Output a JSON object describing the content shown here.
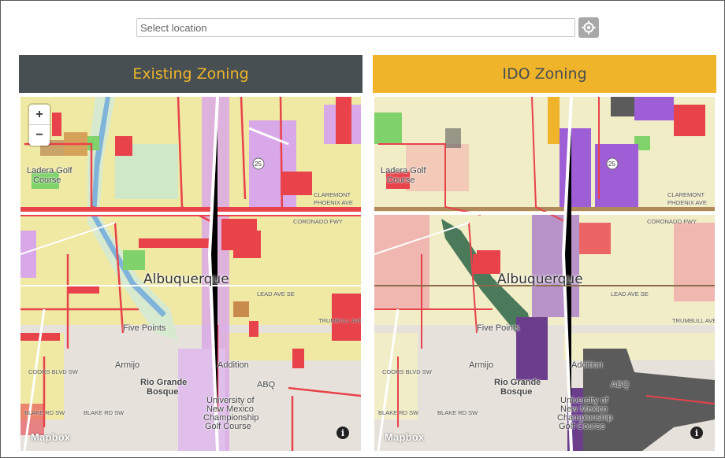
{
  "search": {
    "placeholder": "Select location"
  },
  "locate_icon": "crosshair-target-icon",
  "panels": {
    "existing": {
      "title": "Existing Zoning",
      "title_color": "#efb42a",
      "header_bg": "#474f52"
    },
    "ido": {
      "title": "IDO Zoning",
      "title_color": "#474f52",
      "header_bg": "#efb42a"
    }
  },
  "map": {
    "zoom_in": "+",
    "zoom_out": "−",
    "attribution": "Mapbox",
    "info": "i",
    "labels": {
      "city": "Albuquerque",
      "ladera_golf": "Ladera Golf",
      "ladera_course": "Course",
      "five_points": "Five Points",
      "armijo": "Armijo",
      "rio_grande": "Rio Grande",
      "bosque": "Bosque",
      "unm1": "University of",
      "unm2": "New Mexico",
      "unm3": "Championship",
      "unm4": "Golf Course",
      "abq": "ABQ",
      "addition": "Addition",
      "coronado": "CORONADO FWY",
      "lead": "LEAD AVE SE",
      "trumbull": "TRUMBULL AVE",
      "blake": "BLAKE RD SW",
      "coors": "COORS BLVD SW",
      "claremont1": "CLAREMONT",
      "claremont2": "PHOENIX AVE",
      "i25": "25"
    }
  },
  "colors": {
    "residential": "#efe9a3",
    "commercial": "#e8424a",
    "mixed": "#d9a8e8",
    "park": "#7fd36a",
    "ido_purple": "#9e5fd6",
    "ido_dark": "#6b3e8c",
    "river": "#4a7a5a",
    "airport": "#5b5b5b"
  }
}
